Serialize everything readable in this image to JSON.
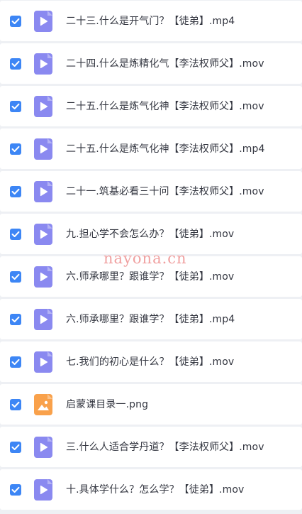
{
  "files": [
    {
      "name": "二十三.什么是开气门？【徒弟】.mp4",
      "type": "video",
      "icon": "video-file-icon",
      "checked": true
    },
    {
      "name": "二十四.什么是炼精化气【李法权师父】.mov",
      "type": "video",
      "icon": "video-file-icon",
      "checked": true
    },
    {
      "name": "二十五.什么是炼气化神【李法权师父】.mov",
      "type": "video",
      "icon": "video-file-icon",
      "checked": true
    },
    {
      "name": "二十五.什么是炼气化神【李法权师父】.mp4",
      "type": "video",
      "icon": "video-file-icon",
      "checked": true
    },
    {
      "name": "二十一.筑基必看三十问【李法权师父】.mov",
      "type": "video",
      "icon": "video-file-icon",
      "checked": true
    },
    {
      "name": "九.担心学不会怎么办？【徒弟】.mov",
      "type": "video",
      "icon": "video-file-icon",
      "checked": true
    },
    {
      "name": "六.师承哪里？跟谁学？【徒弟】.mov",
      "type": "video",
      "icon": "video-file-icon",
      "checked": true
    },
    {
      "name": "六.师承哪里？跟谁学？【徒弟】.mp4",
      "type": "video",
      "icon": "video-file-icon",
      "checked": true
    },
    {
      "name": "七.我们的初心是什么？【徒弟】.mov",
      "type": "video",
      "icon": "video-file-icon",
      "checked": true
    },
    {
      "name": "启蒙课目录一.png",
      "type": "image",
      "icon": "image-file-icon",
      "checked": true
    },
    {
      "name": "三.什么人适合学丹道？【李法权师父】.mov",
      "type": "video",
      "icon": "video-file-icon",
      "checked": true
    },
    {
      "name": "十.具体学什么？怎么学？【徒弟】.mov",
      "type": "video",
      "icon": "video-file-icon",
      "checked": true
    }
  ],
  "watermark": "nayona.cn",
  "colors": {
    "checkbox": "#3d86f5",
    "video_icon": "#8a89f0",
    "image_icon": "#f9a14b",
    "row_bg": "#ffffff",
    "page_bg": "#eef0f4",
    "text": "#333640",
    "watermark": "#f0a0a0"
  }
}
